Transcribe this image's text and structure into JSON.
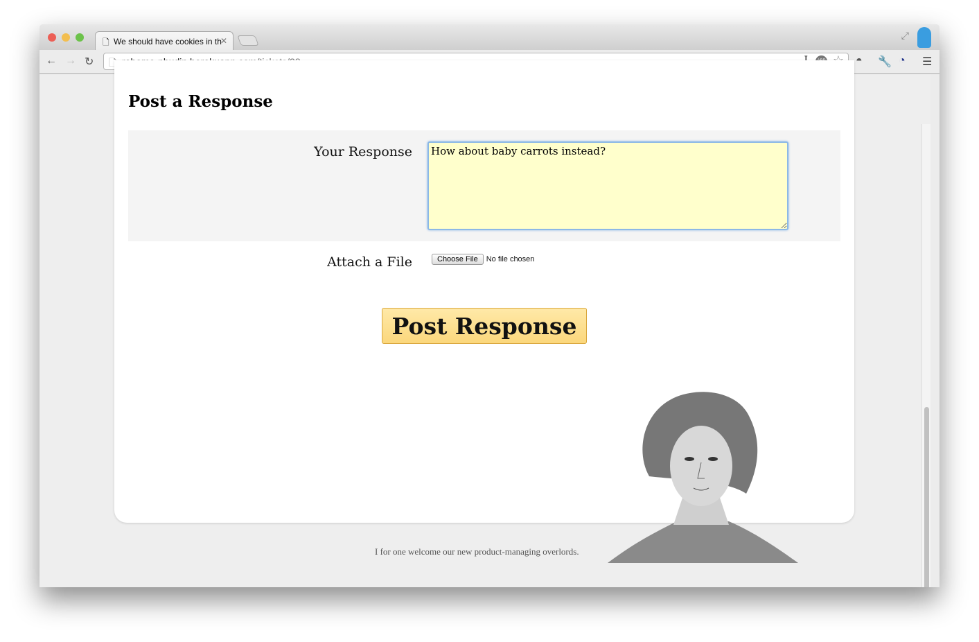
{
  "browser": {
    "tab_title": "We should have cookies in th",
    "url_host": "robomo-nbudin.herokuapp.com",
    "url_path": "/tickets/28"
  },
  "form": {
    "heading": "Post a Response",
    "response_label": "Your Response",
    "response_value": "How about baby carrots instead?",
    "attach_label": "Attach a File",
    "choose_file": "Choose File",
    "no_file": "No file chosen",
    "submit": "Post Response"
  },
  "footer": {
    "text": "I for one welcome our new product-managing overlords."
  },
  "colors": {
    "textarea_bg": "#ffffcc",
    "button_bg": "#fbd77c"
  }
}
